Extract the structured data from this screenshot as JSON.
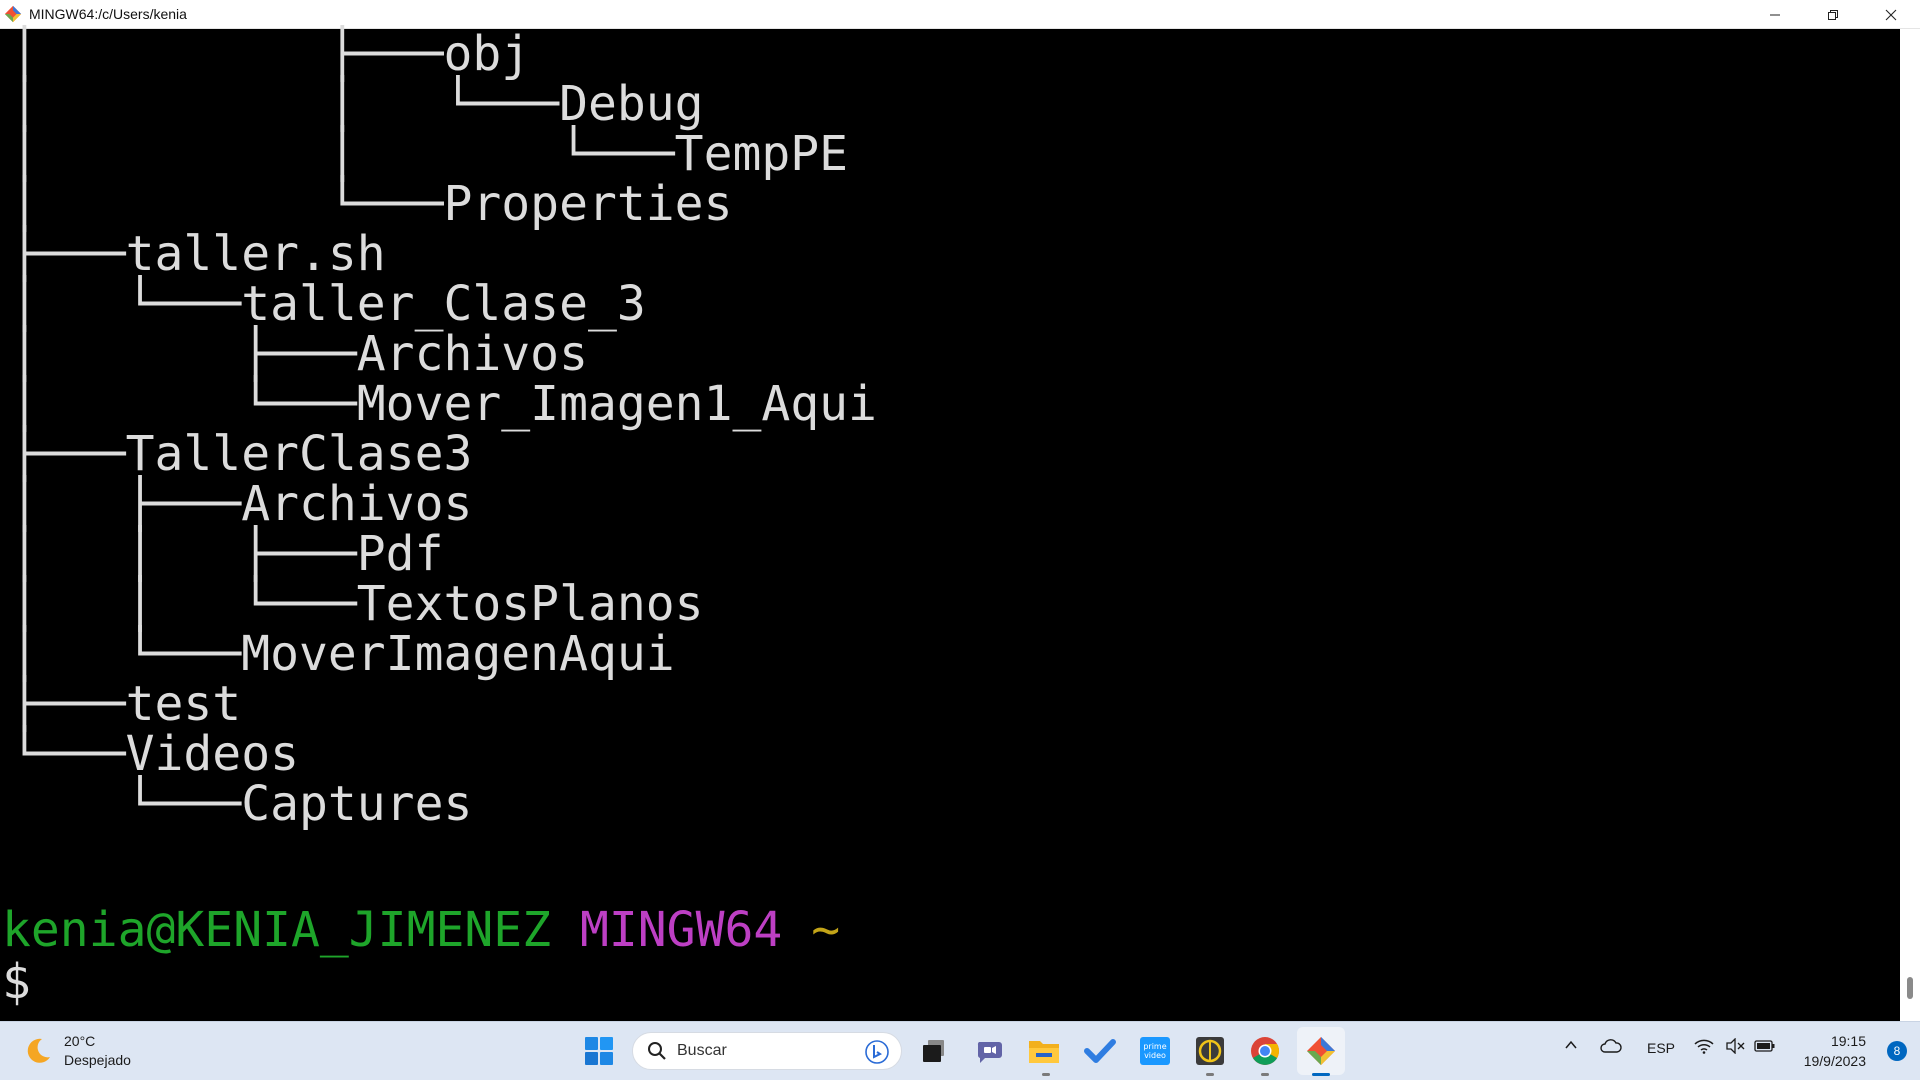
{
  "window": {
    "title": "MINGW64:/c/Users/kenia"
  },
  "terminal": {
    "tree_lines": [
      "│          ├───obj",
      "│          │   └───Debug",
      "│          │       └───TempPE",
      "│          └───Properties",
      "├───taller.sh",
      "│   └───taller_Clase_3",
      "│       ├───Archivos",
      "│       └───Mover_Imagen1_Aqui",
      "├───TallerClase3",
      "│   ├───Archivos",
      "│   │   ├───Pdf",
      "│   │   └───TextosPlanos",
      "│   └───MoverImagenAqui",
      "├───test",
      "└───Videos",
      "    └───Captures"
    ],
    "prompt": {
      "user_host": "kenia@KENIA_JIMENEZ",
      "system": "MINGW64",
      "cwd": "~",
      "symbol": "$"
    },
    "colors": {
      "text": "#dcdcdc",
      "user_host": "#1ea52a",
      "system": "#bd3fc4",
      "cwd": "#c3a418"
    }
  },
  "taskbar": {
    "weather": {
      "temp": "20°C",
      "condition": "Despejado"
    },
    "search": {
      "placeholder": "Buscar"
    },
    "apps": [
      "start-icon",
      "task-view-icon",
      "teams-chat-icon",
      "file-explorer-icon",
      "todo-icon",
      "prime-video-icon",
      "calibre-icon",
      "chrome-icon",
      "git-bash-icon"
    ],
    "tray": {
      "language": "ESP",
      "time": "19:15",
      "date": "19/9/2023",
      "notifications": "8"
    }
  }
}
